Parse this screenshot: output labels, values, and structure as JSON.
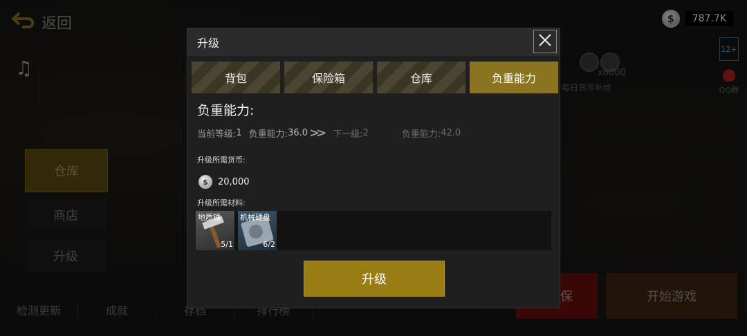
{
  "nav": {
    "back_label": "返回"
  },
  "left_menu": [
    {
      "label": "仓库",
      "active": true
    },
    {
      "label": "商店",
      "active": false
    },
    {
      "label": "升级",
      "active": false
    }
  ],
  "bottom_bar": [
    "检测更新",
    "成就",
    "存档",
    "排行榜"
  ],
  "currency": {
    "value": "787.7K"
  },
  "age_rating": "12+",
  "qq_label": "QQ群",
  "daily_bonus": {
    "amount": "x6000",
    "label": "每日货币补给"
  },
  "buttons": {
    "insure": "投保",
    "start_game": "开始游戏"
  },
  "modal": {
    "title": "升级",
    "tabs": [
      {
        "label": "背包",
        "active": false
      },
      {
        "label": "保险箱",
        "active": false
      },
      {
        "label": "仓库",
        "active": false
      },
      {
        "label": "负重能力",
        "active": true
      }
    ],
    "section_title": "负重能力:",
    "current_level_label": "当前等级:",
    "current_level_value": "1",
    "current_capacity_label": "负重能力:",
    "current_capacity_value": "36.0",
    "next_level_label": "下一级:",
    "next_level_value": "2",
    "next_capacity_label": "负重能力:",
    "next_capacity_value": "42.0",
    "cost_label": "升级所需货币:",
    "cost_value": "20,000",
    "materials_label": "升级所需材料:",
    "materials": [
      {
        "name": "地质锤",
        "count": "5/1"
      },
      {
        "name": "机械硬盘",
        "count": "6/2"
      }
    ],
    "upgrade_button": "升级"
  }
}
